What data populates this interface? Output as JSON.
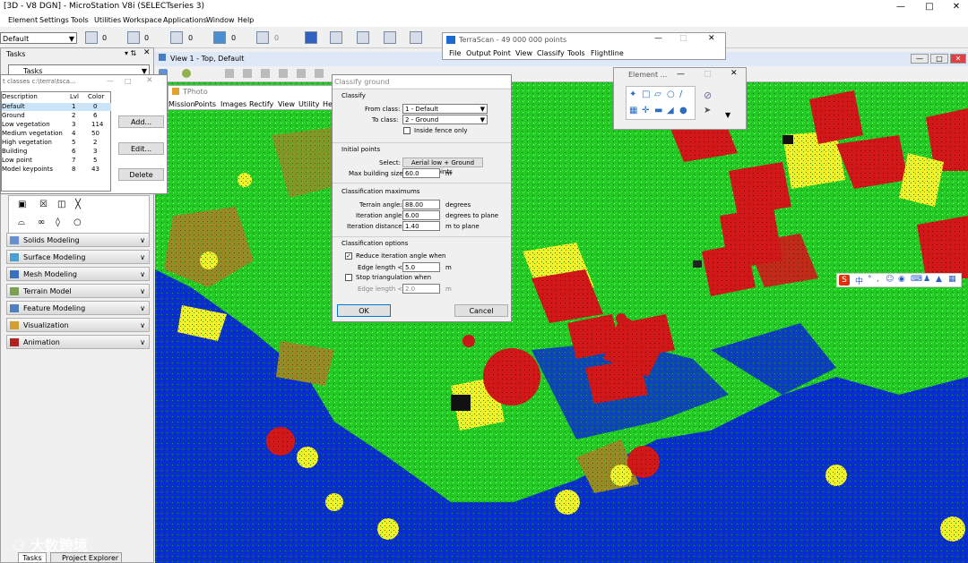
{
  "window": {
    "title": "[3D - V8 DGN] - MicroStation V8i (SELECTseries 3)"
  },
  "menu": [
    "Element",
    "Settings",
    "Tools",
    "Utilities",
    "Workspace",
    "Applications",
    "Window",
    "Help"
  ],
  "toolbar": {
    "level": "Default",
    "values": [
      "0",
      "0",
      "0",
      "0",
      "0"
    ]
  },
  "tasks": {
    "title": "Tasks",
    "combo": "Tasks",
    "sections": [
      "Solids Modeling",
      "Surface Modeling",
      "Mesh Modeling",
      "Terrain Model",
      "Feature Modeling",
      "Visualization",
      "Animation"
    ],
    "bottom_tabs": [
      "Tasks",
      "Project Explorer"
    ]
  },
  "point_classes": {
    "title": "t classes c:\\terra\\tsca...",
    "headers": [
      "Description",
      "Lvl",
      "Color"
    ],
    "rows": [
      {
        "desc": "Default",
        "lvl": "1",
        "color": "0"
      },
      {
        "desc": "Ground",
        "lvl": "2",
        "color": "6"
      },
      {
        "desc": "Low vegetation",
        "lvl": "3",
        "color": "114"
      },
      {
        "desc": "Medium vegetation",
        "lvl": "4",
        "color": "50"
      },
      {
        "desc": "High vegetation",
        "lvl": "5",
        "color": "2"
      },
      {
        "desc": "Building",
        "lvl": "6",
        "color": "3"
      },
      {
        "desc": "Low point",
        "lvl": "7",
        "color": "5"
      },
      {
        "desc": "Model keypoints",
        "lvl": "8",
        "color": "43"
      }
    ],
    "buttons": {
      "add": "Add...",
      "edit": "Edit...",
      "delete": "Delete"
    }
  },
  "tphoto": {
    "title": "TPhoto",
    "menu": [
      "Mission",
      "Points",
      "Images",
      "Rectify",
      "View",
      "Utility",
      "Help"
    ]
  },
  "view": {
    "title": "View 1 - Top, Default"
  },
  "terrascan": {
    "title": "TerraScan - 49 000 000 points",
    "menu": [
      "File",
      "Output",
      "Point",
      "View",
      "Classify",
      "Tools",
      "Flightline"
    ]
  },
  "element": {
    "title": "Element ..."
  },
  "classify_ground": {
    "title": "Classify ground",
    "classify": {
      "group": "Classify",
      "from_label": "From class:",
      "from_value": "1 - Default",
      "to_label": "To class:",
      "to_value": "2 - Ground",
      "fence_label": "Inside fence only"
    },
    "initial": {
      "group": "Initial points",
      "select_label": "Select:",
      "select_value": "Aerial low + Ground points",
      "max_label": "Max building size:",
      "max_value": "60.0",
      "max_unit": "m"
    },
    "maximums": {
      "group": "Classification maximums",
      "terrain_label": "Terrain angle:",
      "terrain_value": "88.00",
      "terrain_unit": "degrees",
      "iter_label": "Iteration angle:",
      "iter_value": "6.00",
      "iter_unit": "degrees to plane",
      "dist_label": "Iteration distance:",
      "dist_value": "1.40",
      "dist_unit": "m to plane"
    },
    "options": {
      "group": "Classification options",
      "reduce_label": "Reduce iteration angle when",
      "edge1_label": "Edge length <",
      "edge1_value": "5.0",
      "edge1_unit": "m",
      "stop_label": "Stop triangulation when",
      "edge2_label": "Edge length <",
      "edge2_value": "2.0",
      "edge2_unit": "m"
    },
    "buttons": {
      "ok": "OK",
      "cancel": "Cancel"
    }
  },
  "watermark": {
    "text": "大数跨境"
  },
  "colors": {
    "ground": "#e04a0a",
    "veg_low": "#1fd51f",
    "veg_high": "#ffff22",
    "building": "#d41a1a",
    "water": "#0a2fd0"
  }
}
